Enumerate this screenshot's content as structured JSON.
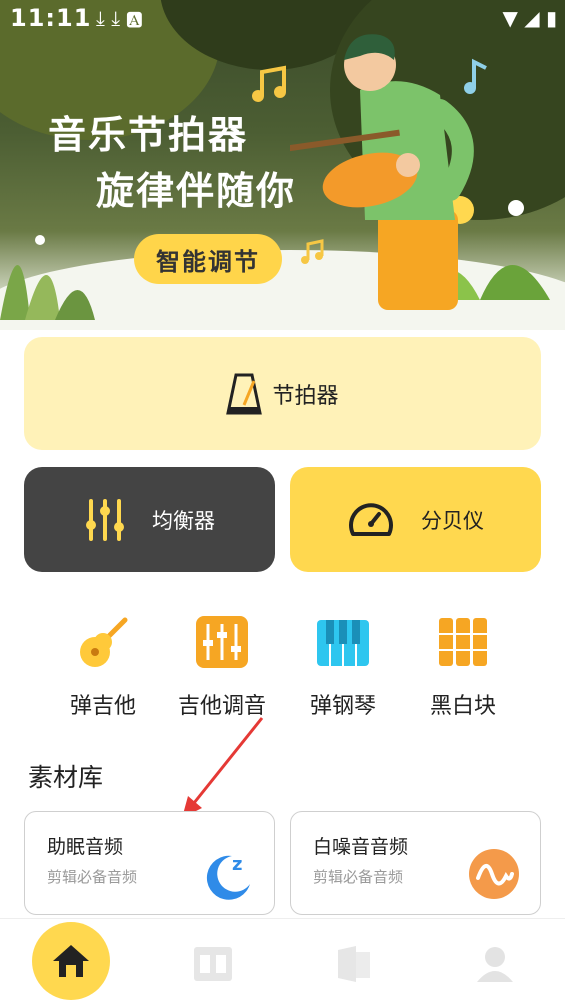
{
  "status_bar": {
    "time": "11:11",
    "left_icons": "⤓ ⤓ 🅰",
    "right_icons": "▼ ◢ ▮"
  },
  "hero": {
    "title": "音乐节拍器",
    "subtitle": "旋律伴随你",
    "button": "智能调节"
  },
  "main_card": {
    "label": "节拍器",
    "icon": "metronome-icon"
  },
  "cards": [
    {
      "label": "均衡器",
      "icon": "equalizer-icon",
      "color": "#444444"
    },
    {
      "label": "分贝仪",
      "icon": "gauge-icon",
      "color": "#ffd84f"
    }
  ],
  "tools": [
    {
      "label": "弹吉他",
      "icon": "guitar-icon"
    },
    {
      "label": "吉他调音",
      "icon": "tuner-icon"
    },
    {
      "label": "弹钢琴",
      "icon": "piano-icon"
    },
    {
      "label": "黑白块",
      "icon": "tiles-icon"
    }
  ],
  "library": {
    "title": "素材库",
    "items": [
      {
        "title": "助眠音频",
        "subtitle": "剪辑必备音频",
        "icon": "moon-sleep-icon"
      },
      {
        "title": "白噪音音频",
        "subtitle": "剪辑必备音频",
        "icon": "wave-icon"
      }
    ]
  },
  "bottom_nav": [
    "home-icon",
    "tools-icon",
    "library-icon",
    "profile-icon"
  ],
  "colors": {
    "accent": "#ffd84f",
    "dark_card": "#444444",
    "light_card": "#fff2b8"
  }
}
